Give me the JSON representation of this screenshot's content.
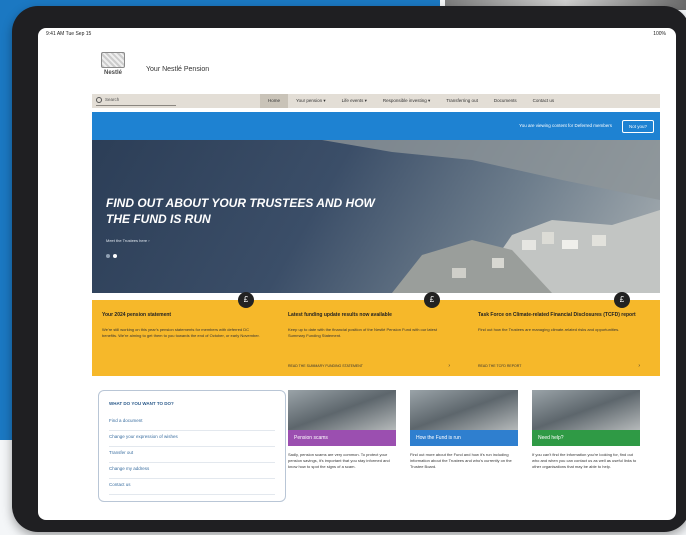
{
  "status_bar": {
    "time": "9:41 AM   Tue Sep 15",
    "battery": "100%"
  },
  "site": {
    "logo_text": "Nestlé",
    "title": "Your Nestlé Pension"
  },
  "search": {
    "placeholder": "Search"
  },
  "nav": [
    "Home",
    "Your pension ▾",
    "Life events ▾",
    "Responsible investing ▾",
    "Transferring out",
    "Documents",
    "Contact us"
  ],
  "banner": {
    "text": "You are viewing content for Deferred members",
    "button": "Not you?"
  },
  "hero": {
    "title": "FIND OUT ABOUT YOUR TRUSTEES AND HOW THE FUND IS RUN",
    "link": "Meet the Trustees here  ›"
  },
  "cards": [
    {
      "title": "Your 2024 pension statement",
      "body": "We're still working on this year's pension statements for members with deferred DC benefits. We're aiming to get them to you towards the end of October, or early November.",
      "link": "",
      "icon": "pound-icon"
    },
    {
      "title": "Latest funding update results now available",
      "body": "Keep up to date with the financial position of the Nestlé Pension Fund with our latest Summary Funding Statement.",
      "link": "READ THE SUMMARY FUNDING STATEMENT",
      "icon": "pound-icon"
    },
    {
      "title": "Task Force on Climate-related Financial Disclosures (TCFD) report",
      "body": "Find out how the Trustees are managing climate-related risks and opportunities.",
      "link": "READ THE TCFD REPORT",
      "icon": "pound-icon"
    }
  ],
  "quick_links": {
    "title": "WHAT DO YOU WANT TO DO?",
    "items": [
      "Find a document",
      "Change your expression of wishes",
      "Transfer out",
      "Change my address",
      "Contact us"
    ]
  },
  "features": [
    {
      "label": "Pension scams",
      "color": "#9b4fb0",
      "text": "Sadly, pension scams are very common. To protect your pension savings, it's important that you stay informed and know how to spot the signs of a scam."
    },
    {
      "label": "How the Fund is run",
      "color": "#2f7fcf",
      "text": "Find out more about the Fund and how it's run including information about the Trustees and who's currently on the Trustee Board."
    },
    {
      "label": "Need help?",
      "color": "#2f9a45",
      "text": "If you can't find the information you're looking for, find out who and when you can contact us as well as useful links to other organisations that may be able to help."
    }
  ]
}
